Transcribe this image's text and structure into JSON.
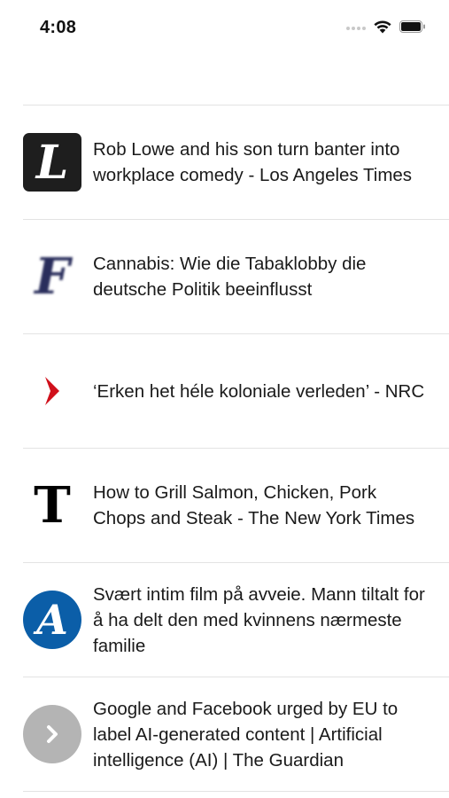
{
  "status_bar": {
    "time": "4:08"
  },
  "news_items": [
    {
      "title": "Rob Lowe and his son turn banter into workplace comedy - Los Angeles Times",
      "logo_letter": "L",
      "icon": "los-angeles-times-logo-icon"
    },
    {
      "title": "Cannabis: Wie die Tabaklobby die deutsche Politik beeinflusst",
      "logo_letter": "F",
      "icon": "faz-logo-icon"
    },
    {
      "title": "‘Erken het héle koloniale verleden’ - NRC",
      "logo_letter": "❯",
      "icon": "nrc-logo-icon"
    },
    {
      "title": "How to Grill Salmon, Chicken, Pork Chops and Steak - The New York Times",
      "logo_letter": "T",
      "icon": "new-york-times-logo-icon"
    },
    {
      "title": "Svært intim film på avveie. Mann tiltalt for å ha delt den med kvinnens nærmeste familie",
      "logo_letter": "A",
      "icon": "aftenposten-logo-icon"
    },
    {
      "title": "Google and Facebook urged by EU to label AI-generated content | Artificial intelligence (AI) | The Guardian",
      "logo_letter": "",
      "icon": "chevron-right-icon"
    }
  ],
  "colors": {
    "separator": "#e3e3e3",
    "nrc_red": "#d0101b",
    "aftenposten_blue": "#0b5ea8",
    "generic_gray": "#b4b4b4"
  }
}
